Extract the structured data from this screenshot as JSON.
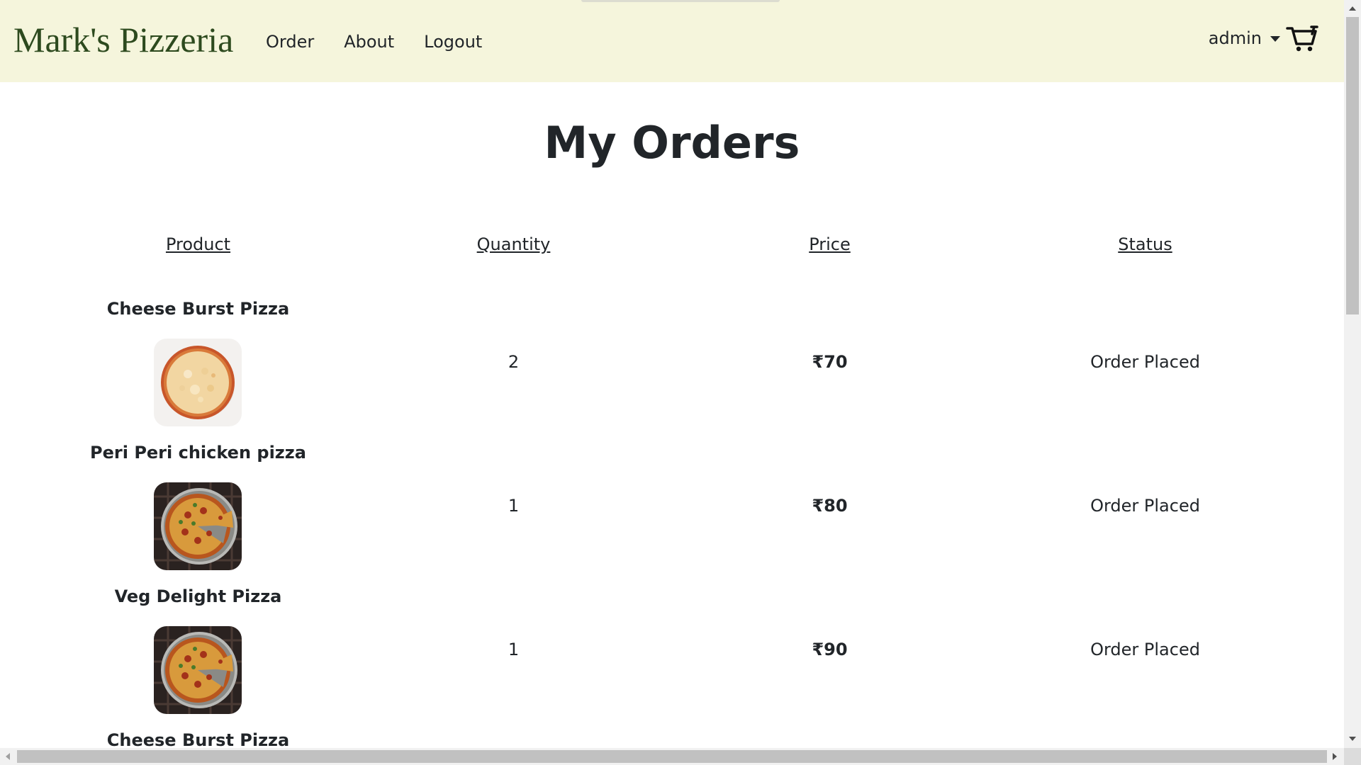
{
  "navbar": {
    "brand": "Mark's Pizzeria",
    "links": [
      "Order",
      "About",
      "Logout"
    ],
    "user": "admin",
    "cart_icon": "cart-icon",
    "background": "#f5f5dc",
    "brand_color": "#2d4a1e"
  },
  "page": {
    "title": "My Orders"
  },
  "table": {
    "headers": [
      "Product",
      "Quantity",
      "Price",
      "Status"
    ],
    "rows": [
      {
        "product": "Cheese Burst Pizza",
        "image": "cheese-pizza-image",
        "quantity": "2",
        "price": "₹70",
        "status": "Order Placed"
      },
      {
        "product": "Peri Peri chicken pizza",
        "image": "pepperoni-pizza-image",
        "quantity": "1",
        "price": "₹80",
        "status": "Order Placed"
      },
      {
        "product": "Veg Delight Pizza",
        "image": "pepperoni-pizza-image",
        "quantity": "1",
        "price": "₹90",
        "status": "Order Placed"
      },
      {
        "product": "Cheese Burst Pizza"
      }
    ]
  }
}
